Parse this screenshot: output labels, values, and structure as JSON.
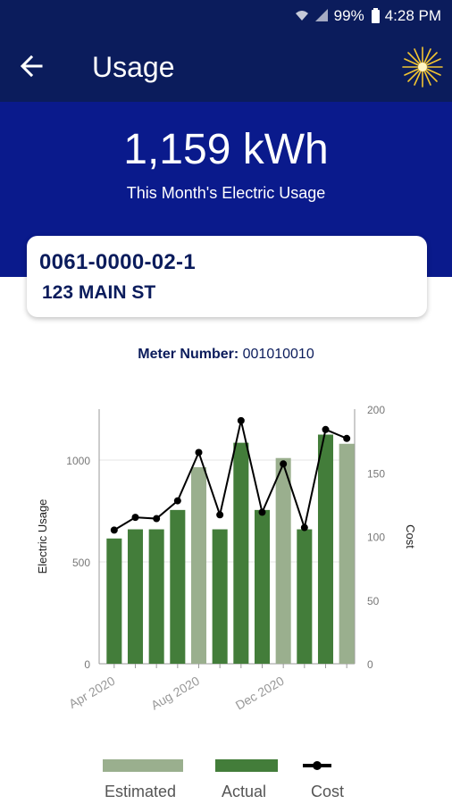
{
  "status": {
    "battery": "99%",
    "time": "4:28 PM",
    "signal_icon": "signal-icon",
    "wifi_icon": "wifi-icon"
  },
  "header": {
    "back_icon": "back-arrow-icon",
    "title": "Usage",
    "logo_icon": "sunburst-logo-icon"
  },
  "summary": {
    "value": "1,159 kWh",
    "label": "This Month's Electric Usage"
  },
  "account": {
    "number": "0061-0000-02-1",
    "address": "123 MAIN ST"
  },
  "meter": {
    "label": "Meter Number:",
    "value": "001010010"
  },
  "colors": {
    "header_bg": "#0b1c5c",
    "hero_bg": "#0a1a8c",
    "estimated": "#9aaf8e",
    "actual": "#437d3a",
    "cost_line": "#000000"
  },
  "chart_data": {
    "type": "bar",
    "x_tick_labels": [
      "Apr 2020",
      "Aug 2020",
      "Dec 2020"
    ],
    "ylabel": "Electric Usage",
    "y2label": "Cost",
    "ylim": [
      0,
      1250
    ],
    "y_ticks": [
      0,
      500,
      1000
    ],
    "y2lim": [
      0,
      200
    ],
    "y2_ticks": [
      0,
      50,
      100,
      150,
      200
    ],
    "grid": "horizontal",
    "legend_placement": "bottom",
    "series": [
      {
        "name": "Estimated / Actual",
        "values": [
          615,
          660,
          660,
          755,
          965,
          660,
          1085,
          755,
          1010,
          660,
          1125,
          1080
        ],
        "kind": [
          "actual",
          "actual",
          "actual",
          "actual",
          "estimated",
          "actual",
          "actual",
          "actual",
          "estimated",
          "actual",
          "actual",
          "estimated"
        ]
      },
      {
        "name": "Cost",
        "values": [
          105,
          115,
          114,
          128,
          166,
          117,
          191,
          119,
          157,
          107,
          184,
          177
        ]
      }
    ],
    "legend": [
      {
        "label": "Estimated",
        "color": "#9aaf8e",
        "kind": "bar"
      },
      {
        "label": "Actual",
        "color": "#437d3a",
        "kind": "bar"
      },
      {
        "label": "Cost",
        "color": "#000000",
        "kind": "line"
      }
    ]
  }
}
